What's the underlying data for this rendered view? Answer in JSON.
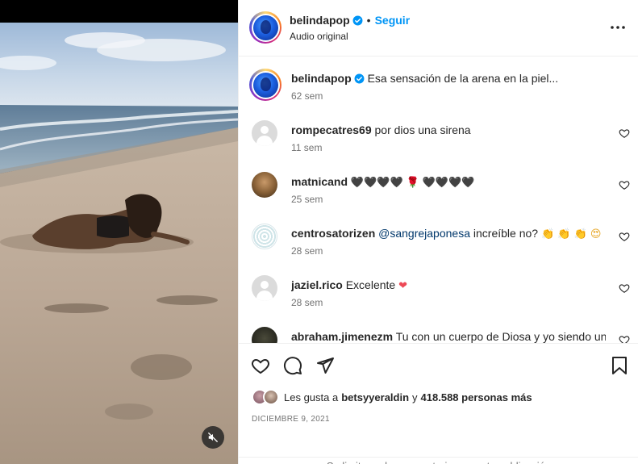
{
  "post": {
    "author": {
      "username": "belindapop",
      "verified": true,
      "follow_label": "Seguir",
      "separator": "•",
      "audio_label": "Audio original"
    },
    "caption": {
      "username": "belindapop",
      "text": "Esa sensación de la arena en la piel...",
      "time": "62 sem"
    },
    "media": {
      "muted": true,
      "icon": "muted-speaker-icon"
    },
    "comments": [
      {
        "username": "rompecatres69",
        "text": "por dios una sirena",
        "time": "11 sem",
        "avatar": "default"
      },
      {
        "username": "matnicand",
        "text_parts": [
          "🖤🖤🖤🖤",
          "🌹",
          "🖤🖤🖤🖤"
        ],
        "time": "25 sem",
        "avatar": "photo"
      },
      {
        "username": "centrosatorizen",
        "mention": "@sangrejaponesa",
        "text": "increíble no?",
        "emoji_tail": "👏 👏 👏 😍",
        "time": "28 sem",
        "avatar": "pattern"
      },
      {
        "username": "jaziel.rico",
        "text": "Excelente",
        "emoji_tail": "❤",
        "time": "28 sem",
        "avatar": "default"
      },
      {
        "username": "abraham.jimenezm",
        "text": "Tu con un cuerpo de Diosa y yo siendo un",
        "avatar": "photo"
      }
    ],
    "likes": {
      "prefix": "Les gusta a",
      "user": "betsyyeraldin",
      "joiner": "y",
      "count_text": "418.588 personas más"
    },
    "date": "DICIEMBRE 9, 2021",
    "comments_limited": "Se limitaron los comentarios en esta publicación"
  },
  "colors": {
    "accent": "#0095f6",
    "text": "#262626",
    "secondary": "#737373",
    "like_red": "#ed4956",
    "verified": "#0095f6"
  }
}
